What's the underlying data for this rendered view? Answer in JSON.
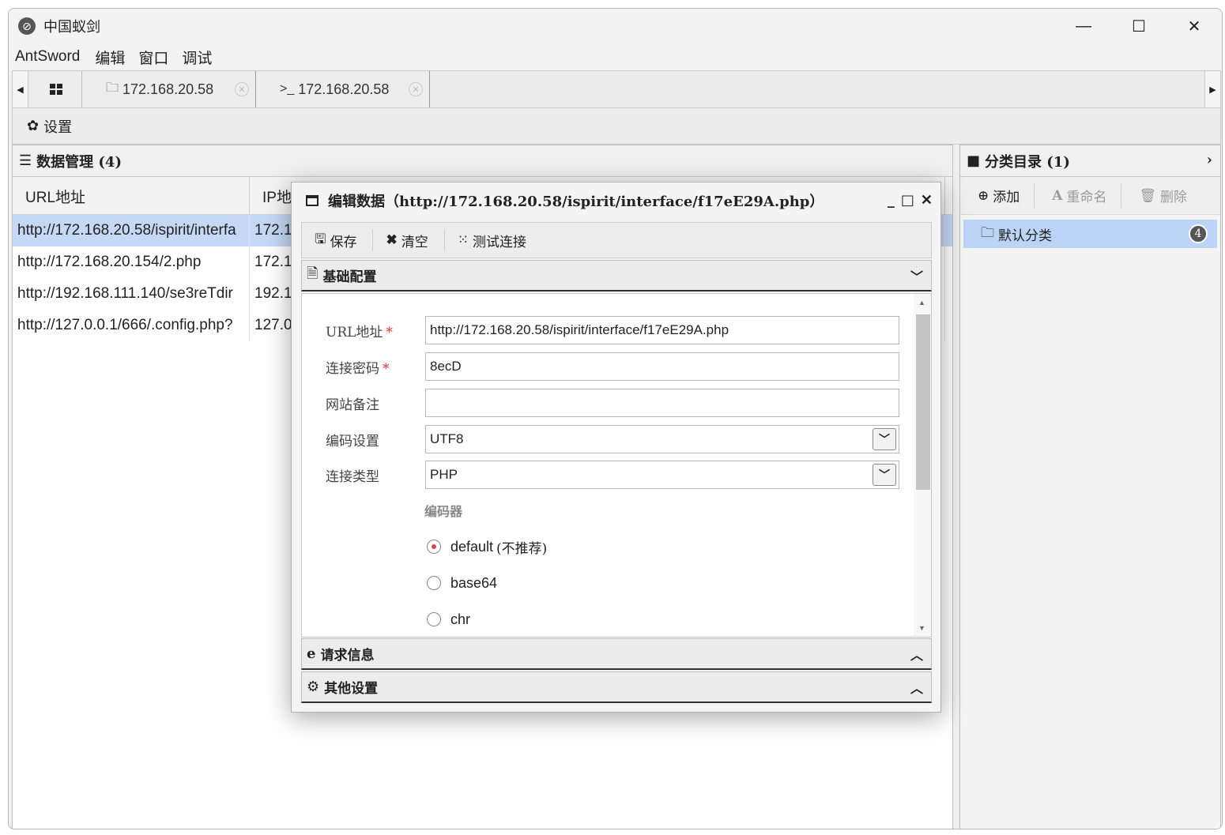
{
  "window": {
    "title": "中国蚁剑",
    "controls": {
      "minimize": "—",
      "maximize": "☐",
      "close": "✕"
    }
  },
  "menu": [
    "AntSword",
    "编辑",
    "窗口",
    "调试"
  ],
  "tabs": [
    {
      "icon": "folder-icon",
      "label": "172.168.20.58"
    },
    {
      "icon": "terminal-icon",
      "label": "172.168.20.58"
    }
  ],
  "toolbar": {
    "settings_label": "设置"
  },
  "data_panel": {
    "title": "数据管理 (4)",
    "columns": [
      "URL地址",
      "IP地"
    ],
    "rows": [
      {
        "url": "http://172.168.20.58/ispirit/interfa",
        "ip": "172.1",
        "selected": true
      },
      {
        "url": "http://172.168.20.154/2.php",
        "ip": "172.1",
        "selected": false
      },
      {
        "url": "http://192.168.111.140/se3reTdir",
        "ip": "192.1",
        "selected": false
      },
      {
        "url": "http://127.0.0.1/666/.config.php?",
        "ip": "127.0",
        "selected": false
      }
    ]
  },
  "category_panel": {
    "title": "分类目录 (1)",
    "buttons": {
      "add": "添加",
      "rename": "重命名",
      "delete": "删除"
    },
    "categories": [
      {
        "name": "默认分类",
        "count": "4"
      }
    ]
  },
  "modal": {
    "title": "编辑数据（http://172.168.20.58/ispirit/interface/f17eE29A.php）",
    "toolbar": {
      "save": "保存",
      "clear": "清空",
      "test": "测试连接"
    },
    "sections": {
      "basic": "基础配置",
      "request": "请求信息",
      "other": "其他设置"
    },
    "form": {
      "url_label": "URL地址",
      "url_value": "http://172.168.20.58/ispirit/interface/f17eE29A.php",
      "password_label": "连接密码",
      "password_value": "8ecD",
      "note_label": "网站备注",
      "note_value": "",
      "encoding_label": "编码设置",
      "encoding_value": "UTF8",
      "type_label": "连接类型",
      "type_value": "PHP",
      "required_mark": "*"
    },
    "encoder": {
      "title": "编码器",
      "options": [
        {
          "label": "default",
          "note": "(不推荐)",
          "checked": true
        },
        {
          "label": "base64",
          "note": "",
          "checked": false
        },
        {
          "label": "chr",
          "note": "",
          "checked": false
        }
      ]
    }
  }
}
